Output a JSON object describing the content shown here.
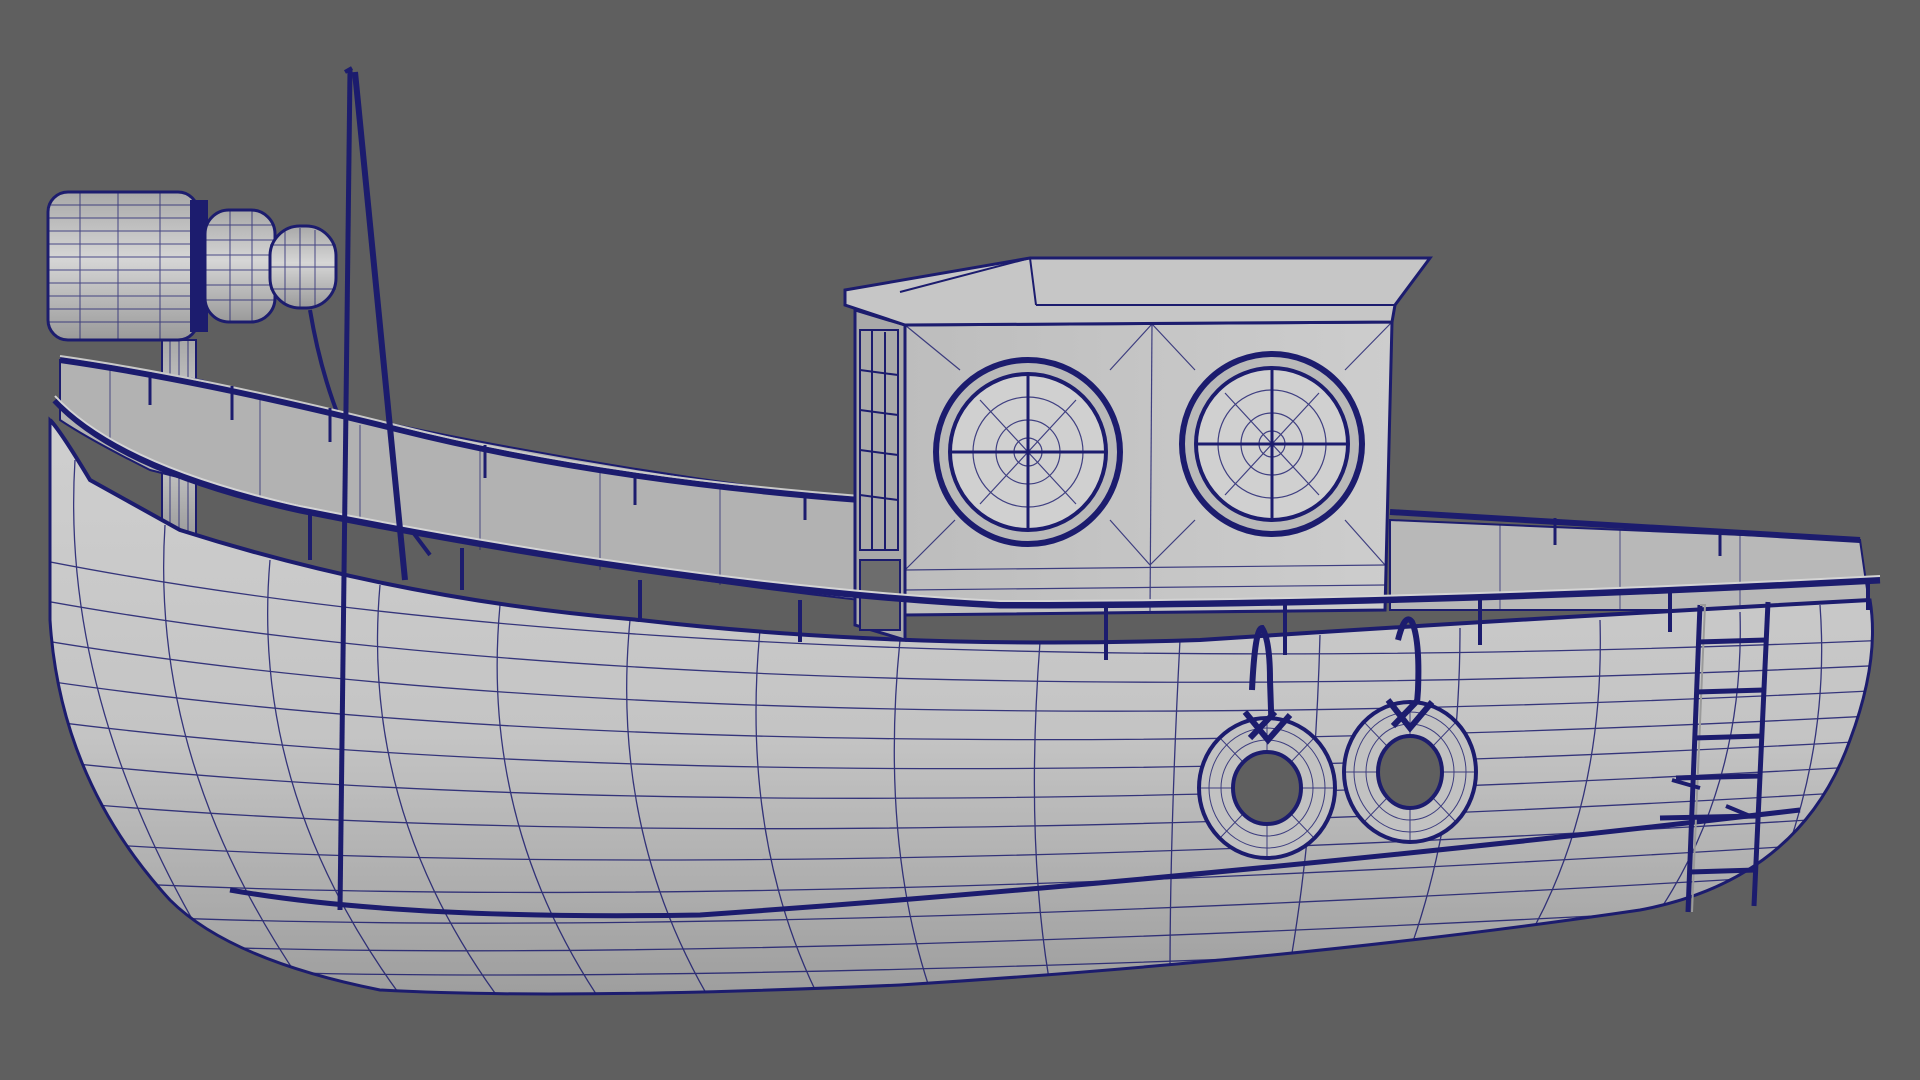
{
  "viewport": {
    "background_color": "#5f5f5f",
    "mesh_fill_color": "#c9c9c9",
    "mesh_shade_color": "#a9a9a9",
    "wire_color": "#1c1c6e",
    "wire_edge_color": "#141460",
    "display_mode": "wireframe-on-shaded",
    "object": "fishing-boat",
    "components": {
      "hull": "boat-hull",
      "cabin": "wheelhouse",
      "portholes": 2,
      "life_rings": 2,
      "ladder": "boarding-ladder",
      "mast": "mast",
      "searchlight": "searchlight"
    }
  }
}
